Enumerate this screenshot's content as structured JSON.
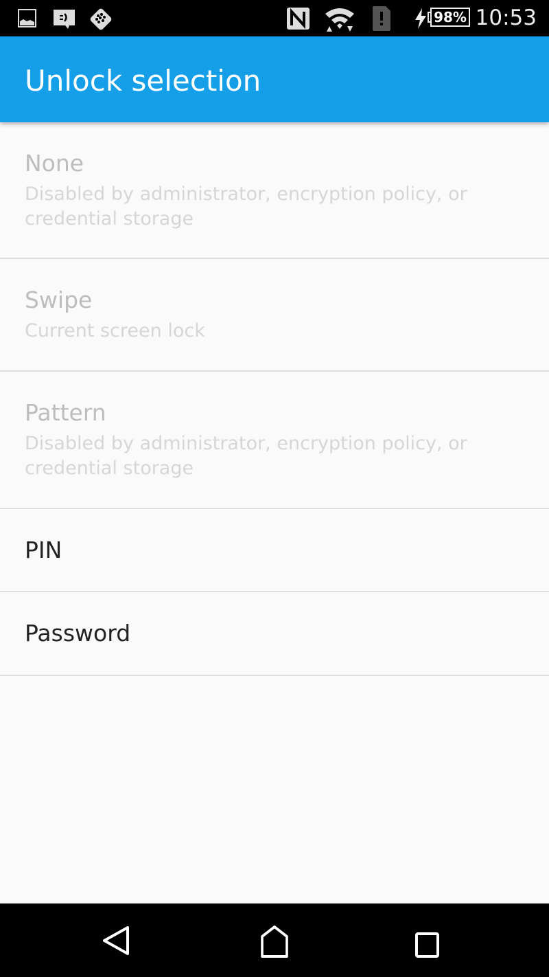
{
  "status_bar": {
    "time": "10:53",
    "battery_percent": "98%",
    "icons": [
      "image-notification-icon",
      "bbm-icon",
      "blackberry-icon",
      "nfc-icon",
      "wifi-icon",
      "sim-alert-icon",
      "charging-icon",
      "battery-icon"
    ]
  },
  "app_bar": {
    "title": "Unlock selection",
    "color": "#149fe8"
  },
  "options": [
    {
      "title": "None",
      "subtitle": "Disabled by administrator, encryption policy, or credential storage",
      "enabled": false
    },
    {
      "title": "Swipe",
      "subtitle": "Current screen lock",
      "enabled": false
    },
    {
      "title": "Pattern",
      "subtitle": "Disabled by administrator, encryption policy, or credential storage",
      "enabled": false
    },
    {
      "title": "PIN",
      "subtitle": "",
      "enabled": true
    },
    {
      "title": "Password",
      "subtitle": "",
      "enabled": true
    }
  ],
  "nav_bar": {
    "buttons": [
      "back",
      "home",
      "recents"
    ]
  }
}
